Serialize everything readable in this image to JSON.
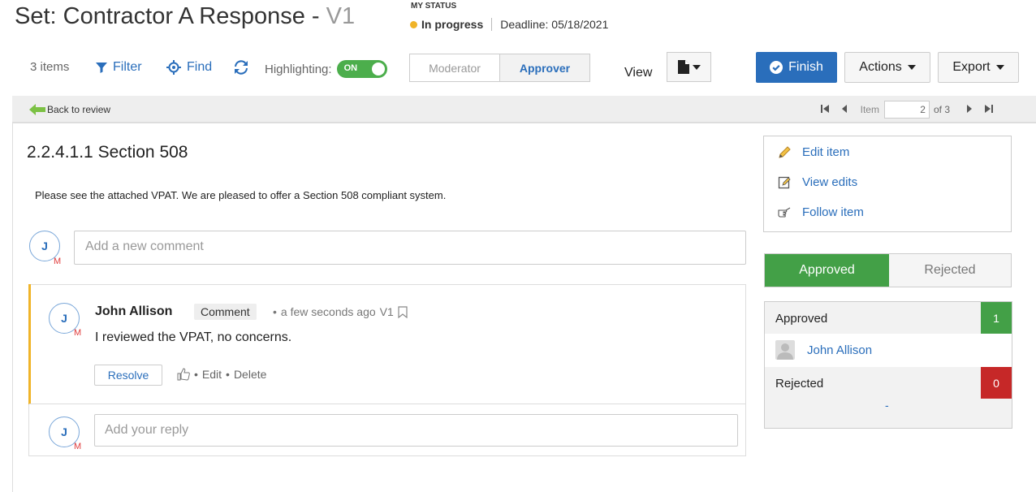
{
  "header": {
    "title": "Set: Contractor A Response - ",
    "version": "V1",
    "status_label": "MY STATUS",
    "status": "In progress",
    "deadline": "Deadline: 05/18/2021",
    "status_color": "#f0b429"
  },
  "toolbar": {
    "items_count": "3 items",
    "filter": "Filter",
    "find": "Find",
    "highlighting": "Highlighting:",
    "toggle_on": "ON",
    "roles": [
      "Moderator",
      "Approver"
    ],
    "selected_role": "Approver",
    "view": "View",
    "finish": "Finish",
    "actions": "Actions",
    "export": "Export"
  },
  "nav": {
    "back": "Back to review",
    "item_label": "Item",
    "item_value": "2",
    "of_total": "of 3"
  },
  "item": {
    "section_title": "2.2.4.1.1 Section 508",
    "response_text": "Please see the attached VPAT. We are pleased to offer a Section 508 compliant system."
  },
  "new_comment": {
    "avatar_initial": "J",
    "avatar_badge": "M",
    "placeholder": "Add a new comment"
  },
  "comment": {
    "avatar_initial": "J",
    "avatar_badge": "M",
    "author": "John Allison",
    "tag": "Comment",
    "time": "a few seconds ago",
    "version": "V1",
    "text": "I reviewed the VPAT, no concerns.",
    "resolve": "Resolve",
    "edit": "Edit",
    "delete": "Delete"
  },
  "reply": {
    "avatar_initial": "J",
    "avatar_badge": "M",
    "placeholder": "Add your reply"
  },
  "side_menu": {
    "edit_item": "Edit item",
    "view_edits": "View edits",
    "follow_item": "Follow item"
  },
  "vote": {
    "approved_tab": "Approved",
    "rejected_tab": "Rejected",
    "selected": "Approved",
    "approved_label": "Approved",
    "approved_count": "1",
    "voter": "John Allison",
    "rejected_label": "Rejected",
    "rejected_count": "0",
    "empty": "-",
    "approved_color": "#43a047",
    "rejected_color": "#c62828"
  },
  "colors": {
    "link": "#2a6ebb",
    "primary": "#2a6ebb"
  }
}
